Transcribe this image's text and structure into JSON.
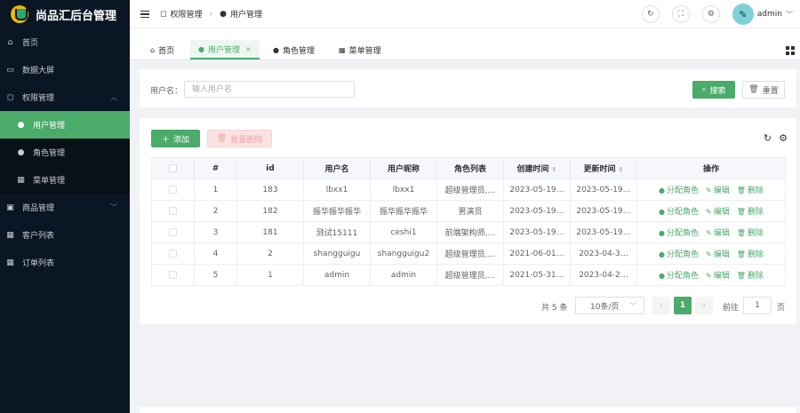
{
  "app": {
    "title": "尚品汇后台管理"
  },
  "sidebar": {
    "items": [
      {
        "label": "首页",
        "icon": "home-icon"
      },
      {
        "label": "数据大屏",
        "icon": "monitor-icon"
      },
      {
        "label": "权限管理",
        "icon": "lock-icon",
        "expanded": true
      },
      {
        "label": "用户管理",
        "icon": "user-icon",
        "active": true
      },
      {
        "label": "角色管理",
        "icon": "user-icon"
      },
      {
        "label": "菜单管理",
        "icon": "grid-icon"
      },
      {
        "label": "商品管理",
        "icon": "goods-icon",
        "expanded": false
      },
      {
        "label": "客户列表",
        "icon": "grid-icon"
      },
      {
        "label": "订单列表",
        "icon": "grid-icon"
      }
    ]
  },
  "header": {
    "breadcrumb": [
      "权限管理",
      "用户管理"
    ],
    "user": "admin"
  },
  "tabs": [
    {
      "label": "首页",
      "icon": "home-icon"
    },
    {
      "label": "用户管理",
      "icon": "user-icon",
      "active": true
    },
    {
      "label": "角色管理",
      "icon": "user-icon"
    },
    {
      "label": "菜单管理",
      "icon": "grid-icon"
    }
  ],
  "search": {
    "label": "用户名：",
    "placeholder": "输入用户名",
    "search_button": "搜索",
    "reset_button": "重置"
  },
  "toolbar": {
    "add_button": "添加",
    "batch_delete_button": "批量删除"
  },
  "table": {
    "headers": [
      "#",
      "id",
      "用户名",
      "用户昵称",
      "角色列表",
      "创建时间",
      "更新时间",
      "操作"
    ],
    "rows": [
      {
        "index": "1",
        "id": "183",
        "username": "lbxx1",
        "nickname": "lbxx1",
        "roles": "超级管理员,…",
        "created": "2023-05-19…",
        "updated": "2023-05-19…"
      },
      {
        "index": "2",
        "id": "182",
        "username": "振华振华振华",
        "nickname": "振华振华振华",
        "roles": "男演员",
        "created": "2023-05-19…",
        "updated": "2023-05-19…"
      },
      {
        "index": "3",
        "id": "181",
        "username": "测试15111",
        "nickname": "ceshi1",
        "roles": "前端架构师,…",
        "created": "2023-05-19…",
        "updated": "2023-05-19…"
      },
      {
        "index": "4",
        "id": "2",
        "username": "shangguigu",
        "nickname": "shangguigu2",
        "roles": "超级管理员,…",
        "created": "2021-06-01…",
        "updated": "2023-04-3…"
      },
      {
        "index": "5",
        "id": "1",
        "username": "admin",
        "nickname": "admin",
        "roles": "超级管理员,…",
        "created": "2021-05-31…",
        "updated": "2023-04-2…"
      }
    ],
    "actions": {
      "assign_role": "分配角色",
      "edit": "编辑",
      "delete": "删除"
    }
  },
  "pagination": {
    "total": "共 5 条",
    "page_size": "10条/页",
    "current_page": "1",
    "goto_label": "前往",
    "goto_value": "1",
    "goto_unit": "页"
  },
  "colors": {
    "accent": "#4aab6a",
    "sidebar_bg": "#0a1623"
  }
}
